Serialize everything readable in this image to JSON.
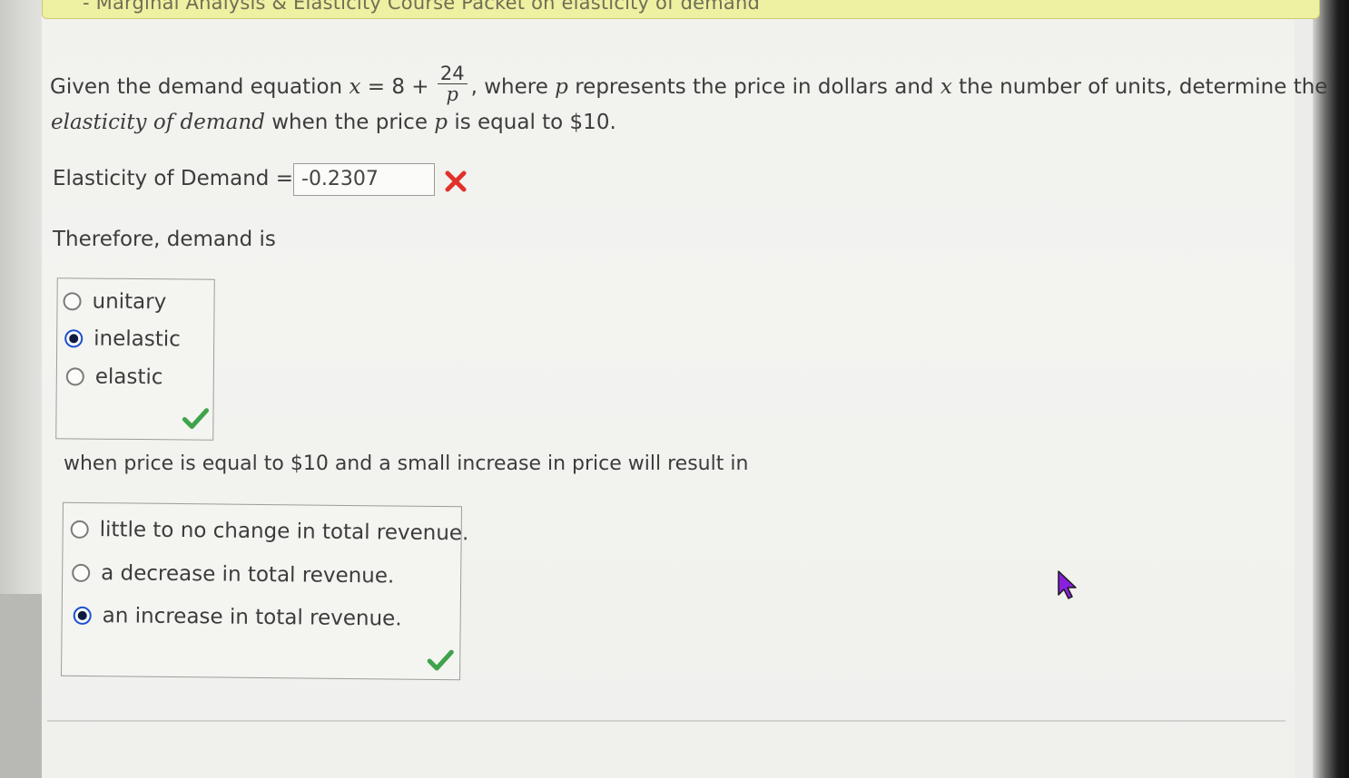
{
  "header": {
    "title": "- Marginal Analysis & Elasticity Course Packet on elasticity of demand"
  },
  "question": {
    "line1_prefix": "Given the demand equation",
    "var_x": "x",
    "equals_8_plus": " = 8 + ",
    "fraction_numerator": "24",
    "fraction_denominator": "p",
    "line1_suffix_a": ", where ",
    "var_p": "p",
    "line1_suffix_b": " represents the price in dollars and ",
    "var_x2": "x",
    "line1_suffix_c": " the number of units, determine the",
    "line2_italic": "elasticity of demand",
    "line2_mid": " when the price ",
    "var_p2": "p",
    "line2_end": " is equal to $10."
  },
  "elasticity": {
    "label": "Elasticity of Demand =",
    "value": "-0.2307",
    "status": "incorrect",
    "status_color": "#e0312b"
  },
  "therefore_text": "Therefore, demand is",
  "demand_type": {
    "options": [
      {
        "label": "unitary",
        "selected": false
      },
      {
        "label": "inelastic",
        "selected": true
      },
      {
        "label": "elastic",
        "selected": false
      }
    ],
    "status": "correct",
    "status_color": "#3ea34a"
  },
  "when_text": "when price is equal to $10 and a small increase in price will result in",
  "revenue": {
    "options": [
      {
        "label": "little to no change in total revenue.",
        "selected": false
      },
      {
        "label": "a decrease in total revenue.",
        "selected": false
      },
      {
        "label": "an increase in total revenue.",
        "selected": true
      }
    ],
    "status": "correct",
    "status_color": "#3ea34a"
  },
  "colors": {
    "header_bg": "#eef0a2",
    "radio_selected": "#1a4fd0",
    "cursor": "#8a1fe0"
  }
}
